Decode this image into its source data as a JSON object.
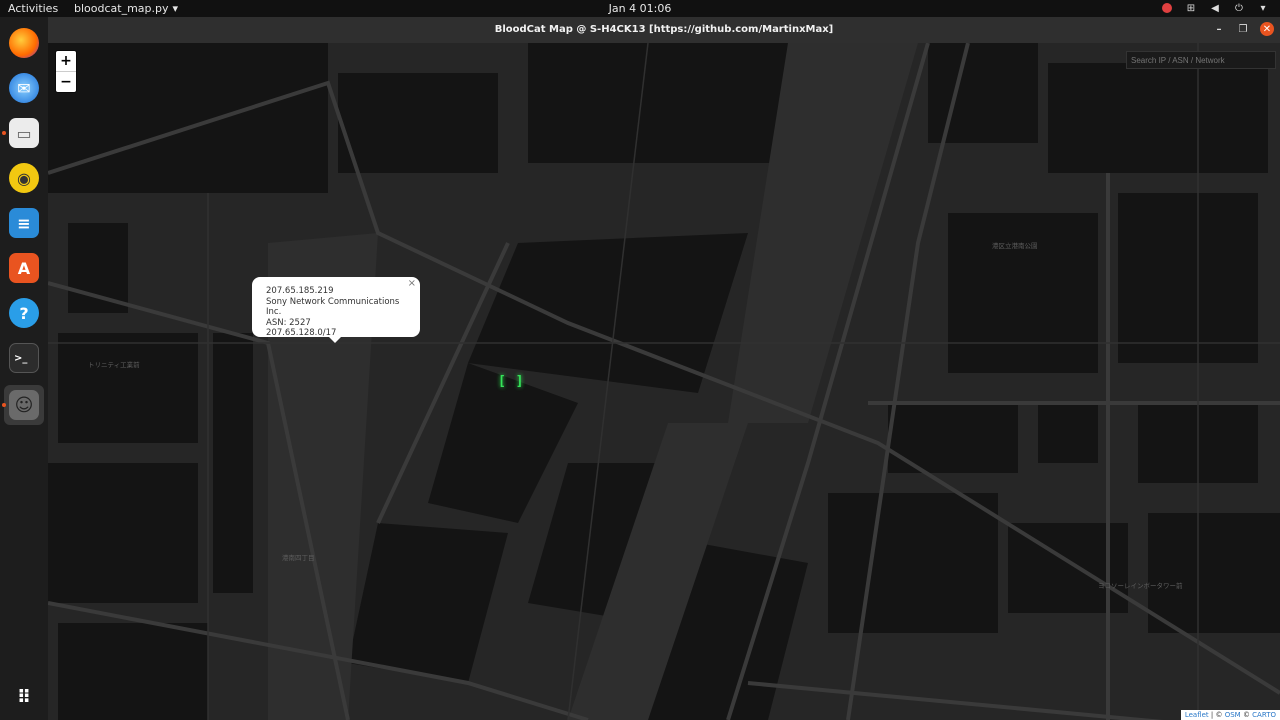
{
  "topbar": {
    "activities": "Activities",
    "app_name": "bloodcat_map.py",
    "clock": "Jan 4  01:06"
  },
  "dock": {
    "items": [
      {
        "name": "Firefox",
        "icon": "firefox-icon"
      },
      {
        "name": "Thunderbird",
        "icon": "thunderbird-icon"
      },
      {
        "name": "Files",
        "icon": "files-icon"
      },
      {
        "name": "Rhythmbox",
        "icon": "rhythmbox-icon"
      },
      {
        "name": "LibreOffice Writer",
        "icon": "writer-icon"
      },
      {
        "name": "Ubuntu Software",
        "icon": "software-icon"
      },
      {
        "name": "Help",
        "icon": "help-icon"
      },
      {
        "name": "Terminal",
        "icon": "terminal-icon"
      },
      {
        "name": "BloodCat",
        "icon": "cat-icon"
      }
    ],
    "show_apps_icon": "grid-icon"
  },
  "window": {
    "title": "BloodCat Map @ S-H4CK13    [https://github.com/MartinxMax]"
  },
  "map": {
    "search_placeholder": "Search IP / ASN / Network",
    "zoom_in": "+",
    "zoom_out": "−",
    "popup": {
      "ip": "207.65.185.219",
      "org": "Sony Network Communications Inc.",
      "asn": "ASN: 2527",
      "network": "207.65.128.0/17",
      "close": "×"
    },
    "marker": "[ ]",
    "attribution": {
      "leaflet": "Leaflet",
      "sep": " | © ",
      "osm": "OSM",
      "copy2": " © ",
      "carto": "CARTO"
    }
  },
  "colors": {
    "ubuntu_orange": "#e95420",
    "marker_green": "#35e35a",
    "map_bg": "#262626"
  }
}
